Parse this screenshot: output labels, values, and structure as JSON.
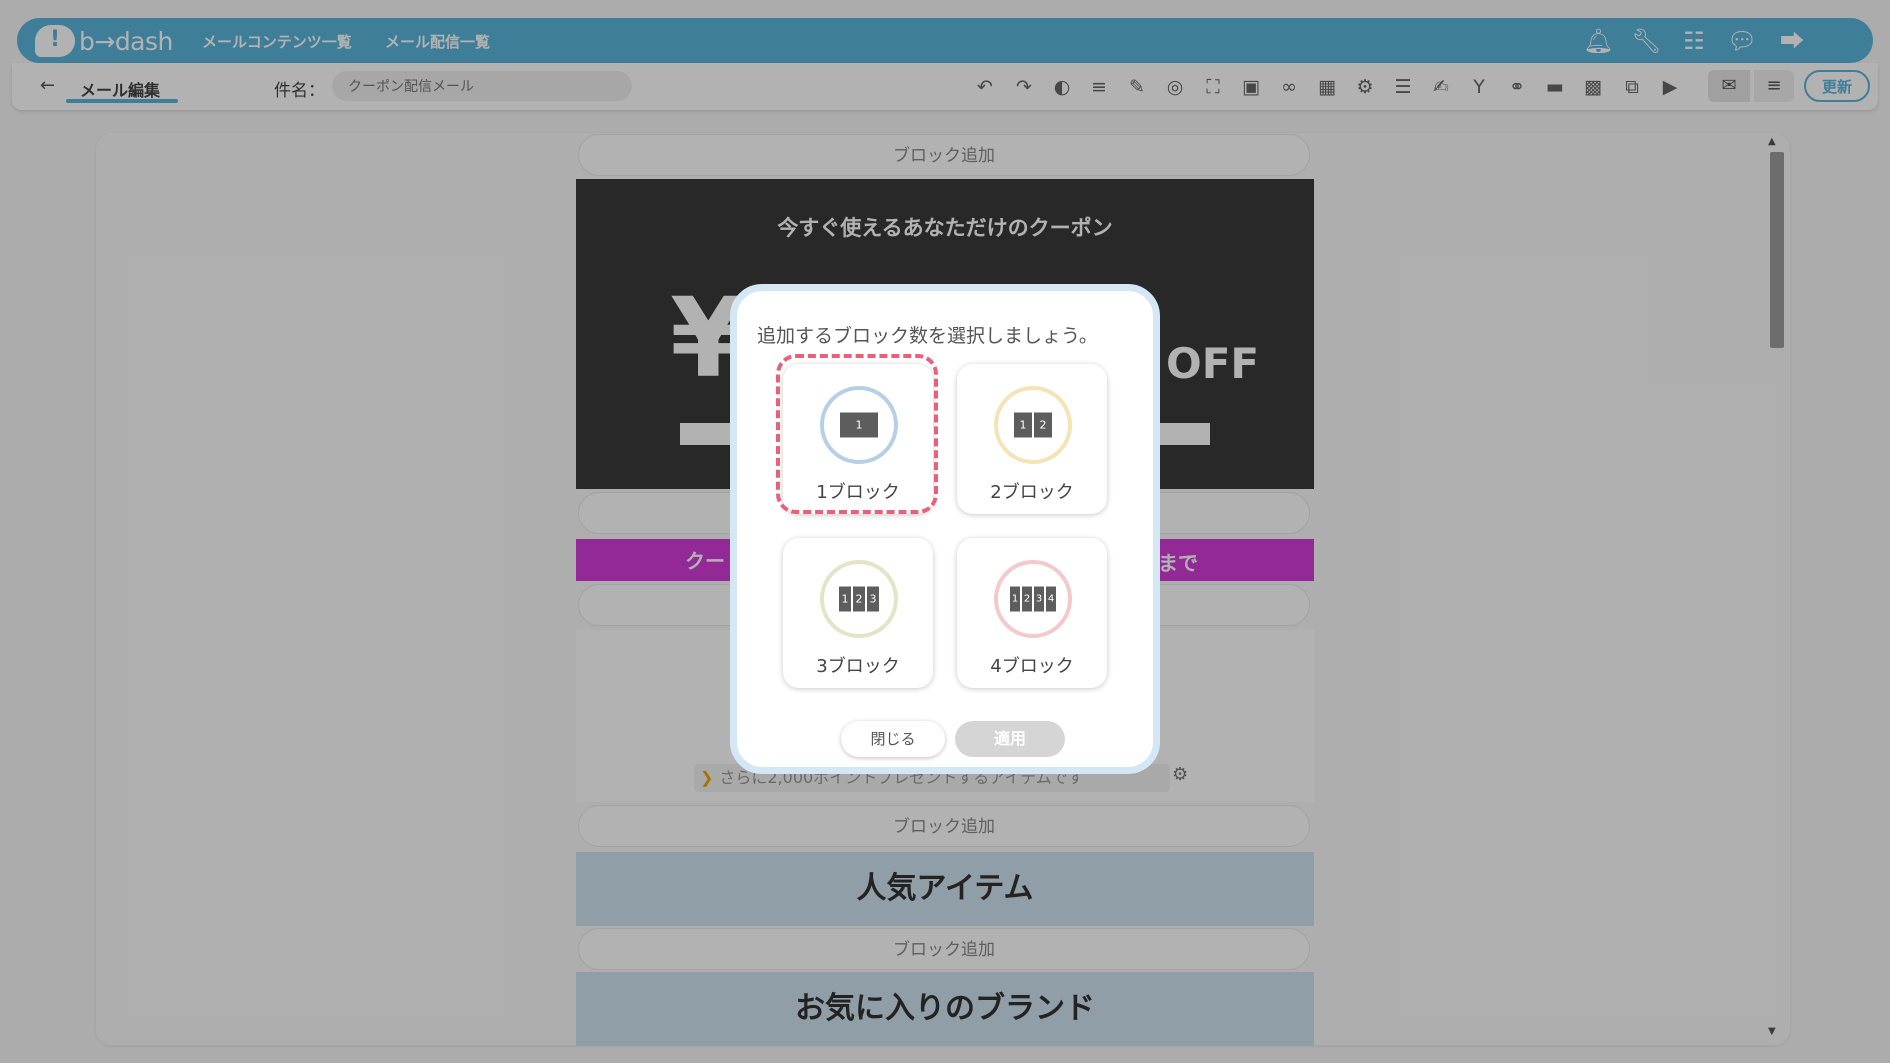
{
  "header": {
    "logo_text": "b→dash",
    "nav": [
      "メールコンテンツ一覧",
      "メール配信一覧"
    ],
    "icons": [
      "bell-icon",
      "wrench-icon",
      "apps-grid-icon",
      "chat-icon",
      "logout-icon"
    ],
    "accent_color": "#5bb5da"
  },
  "toolbar": {
    "back_label": "←",
    "page_title": "メール編集",
    "subject_label": "件名：",
    "subject_value": "クーポン配信メール",
    "tools": [
      "undo-icon",
      "redo-icon",
      "palette-icon",
      "text-align-icon",
      "pen-icon",
      "target-icon",
      "expand-icon",
      "image-icon",
      "link-icon",
      "calendar-icon",
      "gears-icon",
      "database-icon",
      "note-add-icon",
      "merge-icon",
      "link-settings-icon",
      "divider-icon",
      "contact-card-icon",
      "layers-icon",
      "video-icon"
    ],
    "mail_icon": "mail-icon",
    "list_icon": "list-icon",
    "update_label": "更新"
  },
  "canvas": {
    "block_add_label": "ブロック追加",
    "coupon": {
      "title": "今すぐ使えるあなただけのクーポン",
      "yen": "¥",
      "off": "OFF"
    },
    "magenta_left": "クー",
    "magenta_right": "まで",
    "link_text": "さらに2,000ポイントプレゼントするアイテムです",
    "popular_items": "人気アイテム",
    "favorite_brands": "お気に入りのブランド"
  },
  "modal": {
    "title": "追加するブロック数を選択しましょう。",
    "options": [
      {
        "label": "1ブロック",
        "digits": [
          "1"
        ],
        "ring_color": "#b7cfe6",
        "selected": true
      },
      {
        "label": "2ブロック",
        "digits": [
          "1",
          "2"
        ],
        "ring_color": "#f3e3b5",
        "selected": false
      },
      {
        "label": "3ブロック",
        "digits": [
          "1",
          "2",
          "3"
        ],
        "ring_color": "#e2e5c8",
        "selected": false
      },
      {
        "label": "4ブロック",
        "digits": [
          "1",
          "2",
          "3",
          "4"
        ],
        "ring_color": "#f3c9c9",
        "selected": false
      }
    ],
    "close_label": "閉じる",
    "apply_label": "適用",
    "selection_color": "#e8607a"
  }
}
